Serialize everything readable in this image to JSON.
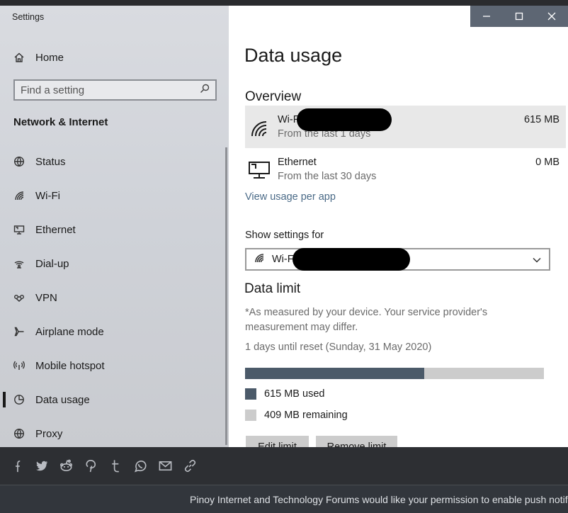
{
  "window": {
    "title": "Settings",
    "controls": [
      "minimize",
      "maximize",
      "close"
    ]
  },
  "sidebar": {
    "home_label": "Home",
    "search_placeholder": "Find a setting",
    "section_title": "Network & Internet",
    "items": [
      {
        "label": "Status",
        "icon": "globe-icon"
      },
      {
        "label": "Wi-Fi",
        "icon": "wifi-icon"
      },
      {
        "label": "Ethernet",
        "icon": "ethernet-icon"
      },
      {
        "label": "Dial-up",
        "icon": "dialup-icon"
      },
      {
        "label": "VPN",
        "icon": "vpn-icon"
      },
      {
        "label": "Airplane mode",
        "icon": "airplane-icon"
      },
      {
        "label": "Mobile hotspot",
        "icon": "hotspot-icon"
      },
      {
        "label": "Data usage",
        "icon": "pie-chart-icon",
        "active": true
      },
      {
        "label": "Proxy",
        "icon": "globe-icon"
      }
    ]
  },
  "main": {
    "title": "Data usage",
    "overview_title": "Overview",
    "overview_rows": [
      {
        "name": "Wi-F",
        "sub": "From the last 1 days",
        "value": "615 MB",
        "icon": "wifi-icon",
        "redacted": true
      },
      {
        "name": "Ethernet",
        "sub": "From the last 30 days",
        "value": "0 MB",
        "icon": "ethernet-icon"
      }
    ],
    "view_usage_link": "View usage per app",
    "show_settings_label": "Show settings for",
    "network_select": {
      "value": "Wi-F",
      "redacted": true
    },
    "data_limit_title": "Data limit",
    "data_limit_note": "*As measured by your device. Your service provider's measurement may differ.",
    "reset_text": "1 days until reset (Sunday, 31 May 2020)",
    "usage_bar": {
      "used_mb": 615,
      "remaining_mb": 409,
      "used_fraction": 0.6
    },
    "legend": [
      {
        "label": "615 MB used",
        "color": "#4b5a69"
      },
      {
        "label": "409 MB remaining",
        "color": "#cccccc"
      }
    ],
    "buttons": {
      "edit_limit": "Edit limit",
      "remove_limit": "Remove limit"
    }
  },
  "share_bar": {
    "icons": [
      "facebook-icon",
      "twitter-icon",
      "reddit-icon",
      "pinterest-icon",
      "tumblr-icon",
      "whatsapp-icon",
      "email-icon",
      "link-icon"
    ]
  },
  "notification": {
    "text": "Pinoy Internet and Technology Forums would like your permission to enable push notif"
  },
  "colors": {
    "accent_bar": "#4b5a69",
    "link": "#4a6a87",
    "titlebar": "#5d6673"
  }
}
